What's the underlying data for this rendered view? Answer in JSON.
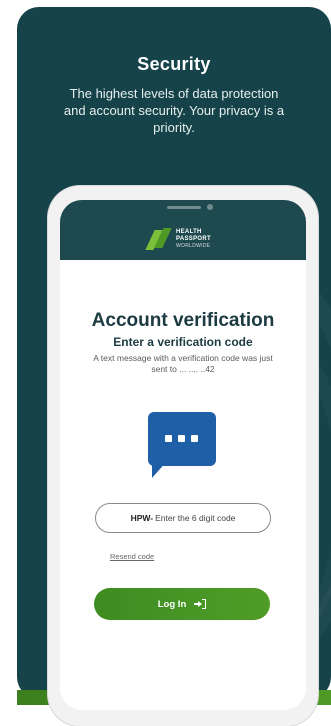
{
  "promo": {
    "headline": "Security",
    "subhead": "The highest levels of data protection and account security. Your privacy is a priority."
  },
  "app": {
    "logo": {
      "line1": "HEALTH",
      "line2": "PASSPORT",
      "line3": "WORLDWIDE"
    },
    "title": "Account verification",
    "subtitle": "Enter a verification code",
    "message": "A text message with a verification code was just sent to ... .... ..42",
    "code_field": {
      "prefix": "HPW-",
      "placeholder": "Enter the 6 digit code"
    },
    "resend_label": "Resend code",
    "login_label": "Log In"
  },
  "colors": {
    "card_bg": "#16434a",
    "accent_green": "#4f9d27",
    "chat_blue": "#1e5fa8"
  },
  "icons": {
    "chat": "chat-bubble-icon",
    "login": "login-icon"
  }
}
